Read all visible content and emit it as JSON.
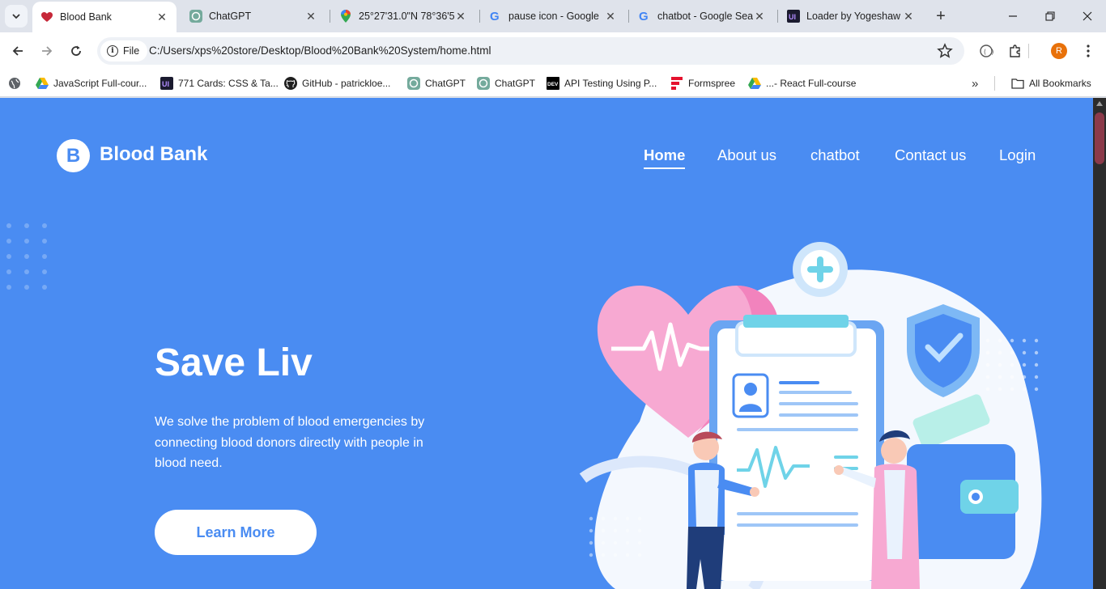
{
  "browser": {
    "tabs": [
      {
        "title": "Blood Bank",
        "icon": "heart-favicon",
        "active": true
      },
      {
        "title": "ChatGPT",
        "icon": "chatgpt-favicon",
        "active": false
      },
      {
        "title": "25°27'31.0\"N 78°36'5",
        "icon": "maps-favicon",
        "active": false
      },
      {
        "title": "pause icon - Google",
        "icon": "google-favicon",
        "active": false
      },
      {
        "title": "chatbot - Google Sea",
        "icon": "google-favicon",
        "active": false
      },
      {
        "title": "Loader by Yogeshaw",
        "icon": "uiverse-favicon",
        "active": false
      }
    ],
    "address_chip": "File",
    "url": "C:/Users/xps%20store/Desktop/Blood%20Bank%20System/home.html",
    "profile_initial": "R",
    "bookmarks": [
      {
        "label": "JavaScript Full-cour...",
        "icon": "drive-icon"
      },
      {
        "label": "771 Cards: CSS & Ta...",
        "icon": "uiverse-icon"
      },
      {
        "label": "GitHub - patrickloe...",
        "icon": "github-icon"
      },
      {
        "label": "ChatGPT",
        "icon": "chatgpt-icon"
      },
      {
        "label": "ChatGPT",
        "icon": "chatgpt-icon"
      },
      {
        "label": "API Testing Using P...",
        "icon": "dev-icon"
      },
      {
        "label": "Formspree",
        "icon": "formspree-icon"
      },
      {
        "label": "...- React Full-course",
        "icon": "drive-icon"
      }
    ],
    "all_bookmarks": "All Bookmarks"
  },
  "site": {
    "logo_letter": "B",
    "brand": "Blood Bank",
    "nav": {
      "home": "Home",
      "about": "About us",
      "chatbot": "chatbot",
      "contact": "Contact us",
      "login": "Login"
    },
    "hero": {
      "title": "Save Liv",
      "description": "We solve the problem of blood emergencies by connecting blood donors directly with people in blood need.",
      "button": "Learn More"
    }
  },
  "colors": {
    "page_bg": "#4a8cf2",
    "accent_pink": "#f58fc0",
    "white": "#ffffff"
  }
}
